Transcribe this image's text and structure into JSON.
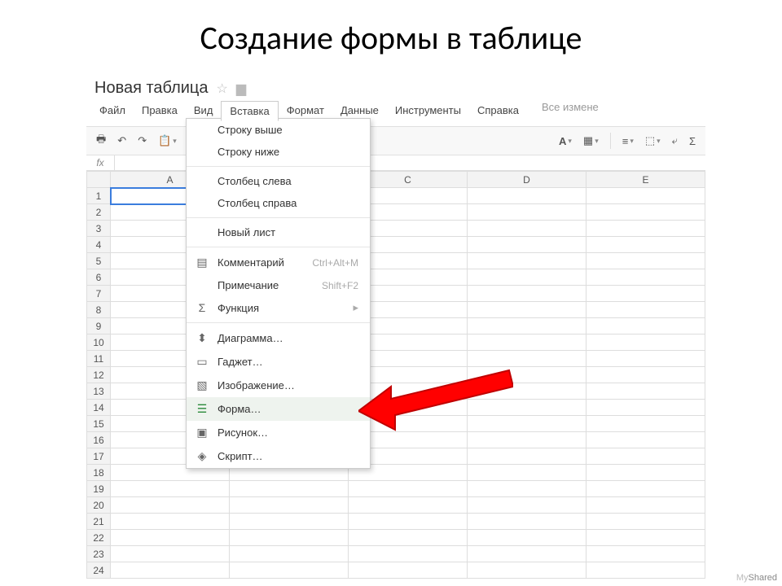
{
  "slide": {
    "title": "Создание формы в таблице"
  },
  "doc": {
    "title": "Новая таблица"
  },
  "menubar": {
    "items": [
      "Файл",
      "Правка",
      "Вид",
      "Вставка",
      "Формат",
      "Данные",
      "Инструменты",
      "Справка"
    ],
    "open_index": 3,
    "status": "Все измене"
  },
  "fx": {
    "label": "fx"
  },
  "columns": [
    "A",
    "B",
    "C",
    "D",
    "E"
  ],
  "row_count": 24,
  "dropdown": {
    "groups": [
      [
        {
          "icon": "",
          "label": "Строку выше",
          "shortcut": ""
        },
        {
          "icon": "",
          "label": "Строку ниже",
          "shortcut": ""
        }
      ],
      [
        {
          "icon": "",
          "label": "Столбец слева",
          "shortcut": ""
        },
        {
          "icon": "",
          "label": "Столбец справа",
          "shortcut": ""
        }
      ],
      [
        {
          "icon": "",
          "label": "Новый лист",
          "shortcut": ""
        }
      ],
      [
        {
          "icon": "comment",
          "label": "Комментарий",
          "shortcut": "Ctrl+Alt+M"
        },
        {
          "icon": "",
          "label": "Примечание",
          "shortcut": "Shift+F2"
        },
        {
          "icon": "sigma",
          "label": "Функция",
          "shortcut": "",
          "submenu": true
        }
      ],
      [
        {
          "icon": "chart",
          "label": "Диаграмма…",
          "shortcut": ""
        },
        {
          "icon": "gadget",
          "label": "Гаджет…",
          "shortcut": ""
        },
        {
          "icon": "image",
          "label": "Изображение…",
          "shortcut": ""
        },
        {
          "icon": "form",
          "label": "Форма…",
          "shortcut": "",
          "highlight": true
        },
        {
          "icon": "drawing",
          "label": "Рисунок…",
          "shortcut": ""
        },
        {
          "icon": "script",
          "label": "Скрипт…",
          "shortcut": ""
        }
      ]
    ]
  },
  "watermark": {
    "a": "My",
    "b": "Shared"
  }
}
